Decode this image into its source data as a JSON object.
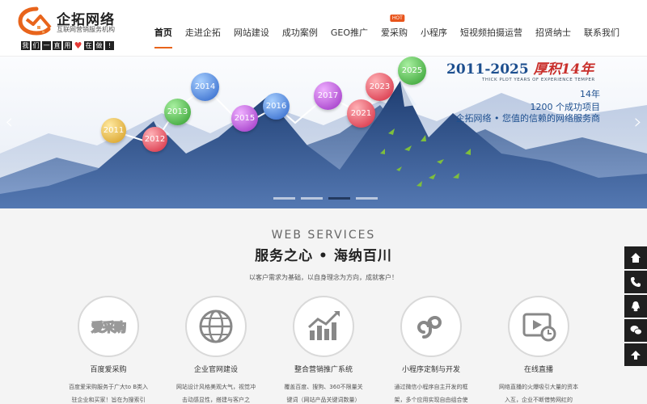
{
  "logo": {
    "title": "企拓网络",
    "subtitle": "互联网营销服务机构",
    "slogan_chars": [
      "我",
      "们",
      "一",
      "直",
      "用",
      "心",
      "在",
      "做",
      "!"
    ]
  },
  "nav": {
    "items": [
      {
        "label": "首页",
        "active": true
      },
      {
        "label": "走进企拓"
      },
      {
        "label": "网站建设"
      },
      {
        "label": "成功案例"
      },
      {
        "label": "GEO推广"
      },
      {
        "label": "爱采购",
        "badge": "HOT"
      },
      {
        "label": "小程序"
      },
      {
        "label": "短视频拍摄运营"
      },
      {
        "label": "招贤纳士"
      },
      {
        "label": "联系我们"
      }
    ]
  },
  "banner": {
    "years": [
      "2011",
      "2012",
      "2013",
      "2014",
      "2015",
      "2016",
      "2017",
      "2021",
      "2023",
      "2025"
    ],
    "title_years": "2011-2025",
    "title_cn": "厚积14年",
    "tagline": "THICK PLOT YEARS OF EXPERIENCE TEMPER",
    "line1": "14年",
    "line2": "1200 个成功项目",
    "line3": "企拓网络 • 您值的信赖的网络服务商",
    "prev_arrow": "‹",
    "next_arrow": "›"
  },
  "services": {
    "en_title": "WEB SERVICES",
    "title": "服务之心 • 海纳百川",
    "desc": "以客户需求为基础，以自身理念为方向，成就客户！",
    "items": [
      {
        "title": "百度爱采购",
        "desc": "百度爱采购服务于广大to B类入驻企业和买家！旨在为搜索引",
        "icon": "aicaigou-logo-icon",
        "icon_text": "爱采购"
      },
      {
        "title": "企业官网建设",
        "desc": "网站设计风格美观大气，视觉冲击动感显性，搭建与客户之",
        "icon": "globe-icon"
      },
      {
        "title": "整合营销推广系统",
        "desc": "覆盖百度、搜狗、360不限量关键词（网站产品关键词数量）",
        "icon": "growth-chart-icon"
      },
      {
        "title": "小程序定制与开发",
        "desc": "通过微信小程序自主开发的框架，多个应用实现自由组合使",
        "icon": "mini-program-icon"
      },
      {
        "title": "在线直播",
        "desc": "网络直播的火爆吸引大量的资本入互，企业不断借势网红的",
        "icon": "live-video-icon"
      }
    ]
  },
  "sidebar_tools": [
    "home-icon",
    "phone-icon",
    "qq-icon",
    "wechat-icon",
    "back-to-top-icon"
  ],
  "colors": {
    "accent": "#e8641b",
    "banner_sky": "#f3f6fb",
    "mountain_dark": "#21447a",
    "mountain_light": "#5d7fb6",
    "title_blue": "#1d4f8f"
  }
}
